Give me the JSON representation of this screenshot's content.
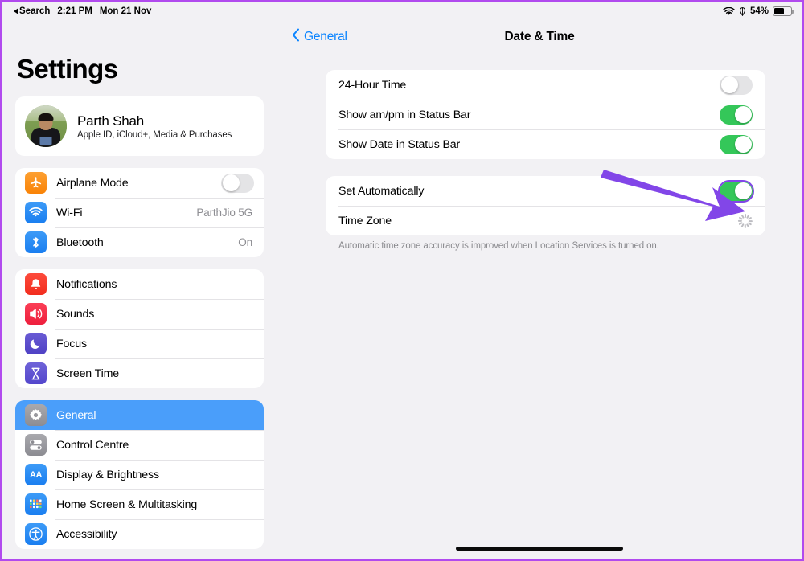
{
  "status_bar": {
    "back_label": "Search",
    "time": "2:21 PM",
    "date": "Mon 21 Nov",
    "wifi_icon": "wifi-icon",
    "location_icon": "location-services-icon",
    "battery_percent": "54%",
    "battery_icon": "battery-icon"
  },
  "sidebar": {
    "title": "Settings",
    "profile": {
      "name": "Parth Shah",
      "subtitle": "Apple ID, iCloud+, Media & Purchases",
      "avatar": "user-avatar"
    },
    "groups": [
      {
        "items": [
          {
            "label": "Airplane Mode",
            "icon": "airplane-icon",
            "icon_color": "#f98307",
            "control": "toggle",
            "toggle_on": false
          },
          {
            "label": "Wi-Fi",
            "icon": "wifi-icon",
            "icon_color": "#1a7ef0",
            "control": "value",
            "value": "ParthJio 5G"
          },
          {
            "label": "Bluetooth",
            "icon": "bluetooth-icon",
            "icon_color": "#1a7ef0",
            "control": "value",
            "value": "On"
          }
        ]
      },
      {
        "items": [
          {
            "label": "Notifications",
            "icon": "bell-icon",
            "icon_color": "#f22d1e",
            "control": "none"
          },
          {
            "label": "Sounds",
            "icon": "speaker-icon",
            "icon_color": "#ee1f3d",
            "control": "none"
          },
          {
            "label": "Focus",
            "icon": "moon-icon",
            "icon_color": "#4f41c4",
            "control": "none"
          },
          {
            "label": "Screen Time",
            "icon": "hourglass-icon",
            "icon_color": "#5346cc",
            "control": "none"
          }
        ]
      },
      {
        "items": [
          {
            "label": "General",
            "icon": "gear-icon",
            "icon_color": "#8c8c92",
            "control": "none",
            "selected": true
          },
          {
            "label": "Control Centre",
            "icon": "sliders-icon",
            "icon_color": "#8c8c92",
            "control": "none"
          },
          {
            "label": "Display & Brightness",
            "icon": "aa-text-icon",
            "icon_color": "#1a7ef0",
            "control": "none"
          },
          {
            "label": "Home Screen & Multitasking",
            "icon": "app-grid-icon",
            "icon_color": "#1a7ef0",
            "control": "none"
          },
          {
            "label": "Accessibility",
            "icon": "accessibility-icon",
            "icon_color": "#1a7ef0",
            "control": "none"
          }
        ]
      }
    ]
  },
  "detail": {
    "back_label": "General",
    "title": "Date & Time",
    "groups": [
      {
        "rows": [
          {
            "label": "24-Hour Time",
            "control": "toggle",
            "toggle_on": false,
            "highlighted": false
          },
          {
            "label": "Show am/pm in Status Bar",
            "control": "toggle",
            "toggle_on": true,
            "highlighted": false
          },
          {
            "label": "Show Date in Status Bar",
            "control": "toggle",
            "toggle_on": true,
            "highlighted": false
          }
        ],
        "footer": ""
      },
      {
        "rows": [
          {
            "label": "Set Automatically",
            "control": "toggle",
            "toggle_on": true,
            "highlighted": true
          },
          {
            "label": "Time Zone",
            "control": "spinner"
          }
        ],
        "footer": "Automatic time zone accuracy is improved when Location Services is turned on."
      }
    ]
  },
  "annotation": {
    "arrow_color": "#8246e8",
    "arrow_name": "purple-arrow-annotation",
    "target": "Set Automatically"
  },
  "colors": {
    "accent_blue": "#0a84ff",
    "selected_row": "#4a9efa",
    "toggle_on_green": "#34c759",
    "toggle_off_gray": "#e4e4e6",
    "page_background": "#f2f1f4",
    "card_background": "#ffffff",
    "highlight_purple": "#8246e8",
    "border_purple": "#b14aee"
  },
  "home_indicator": "home-indicator"
}
